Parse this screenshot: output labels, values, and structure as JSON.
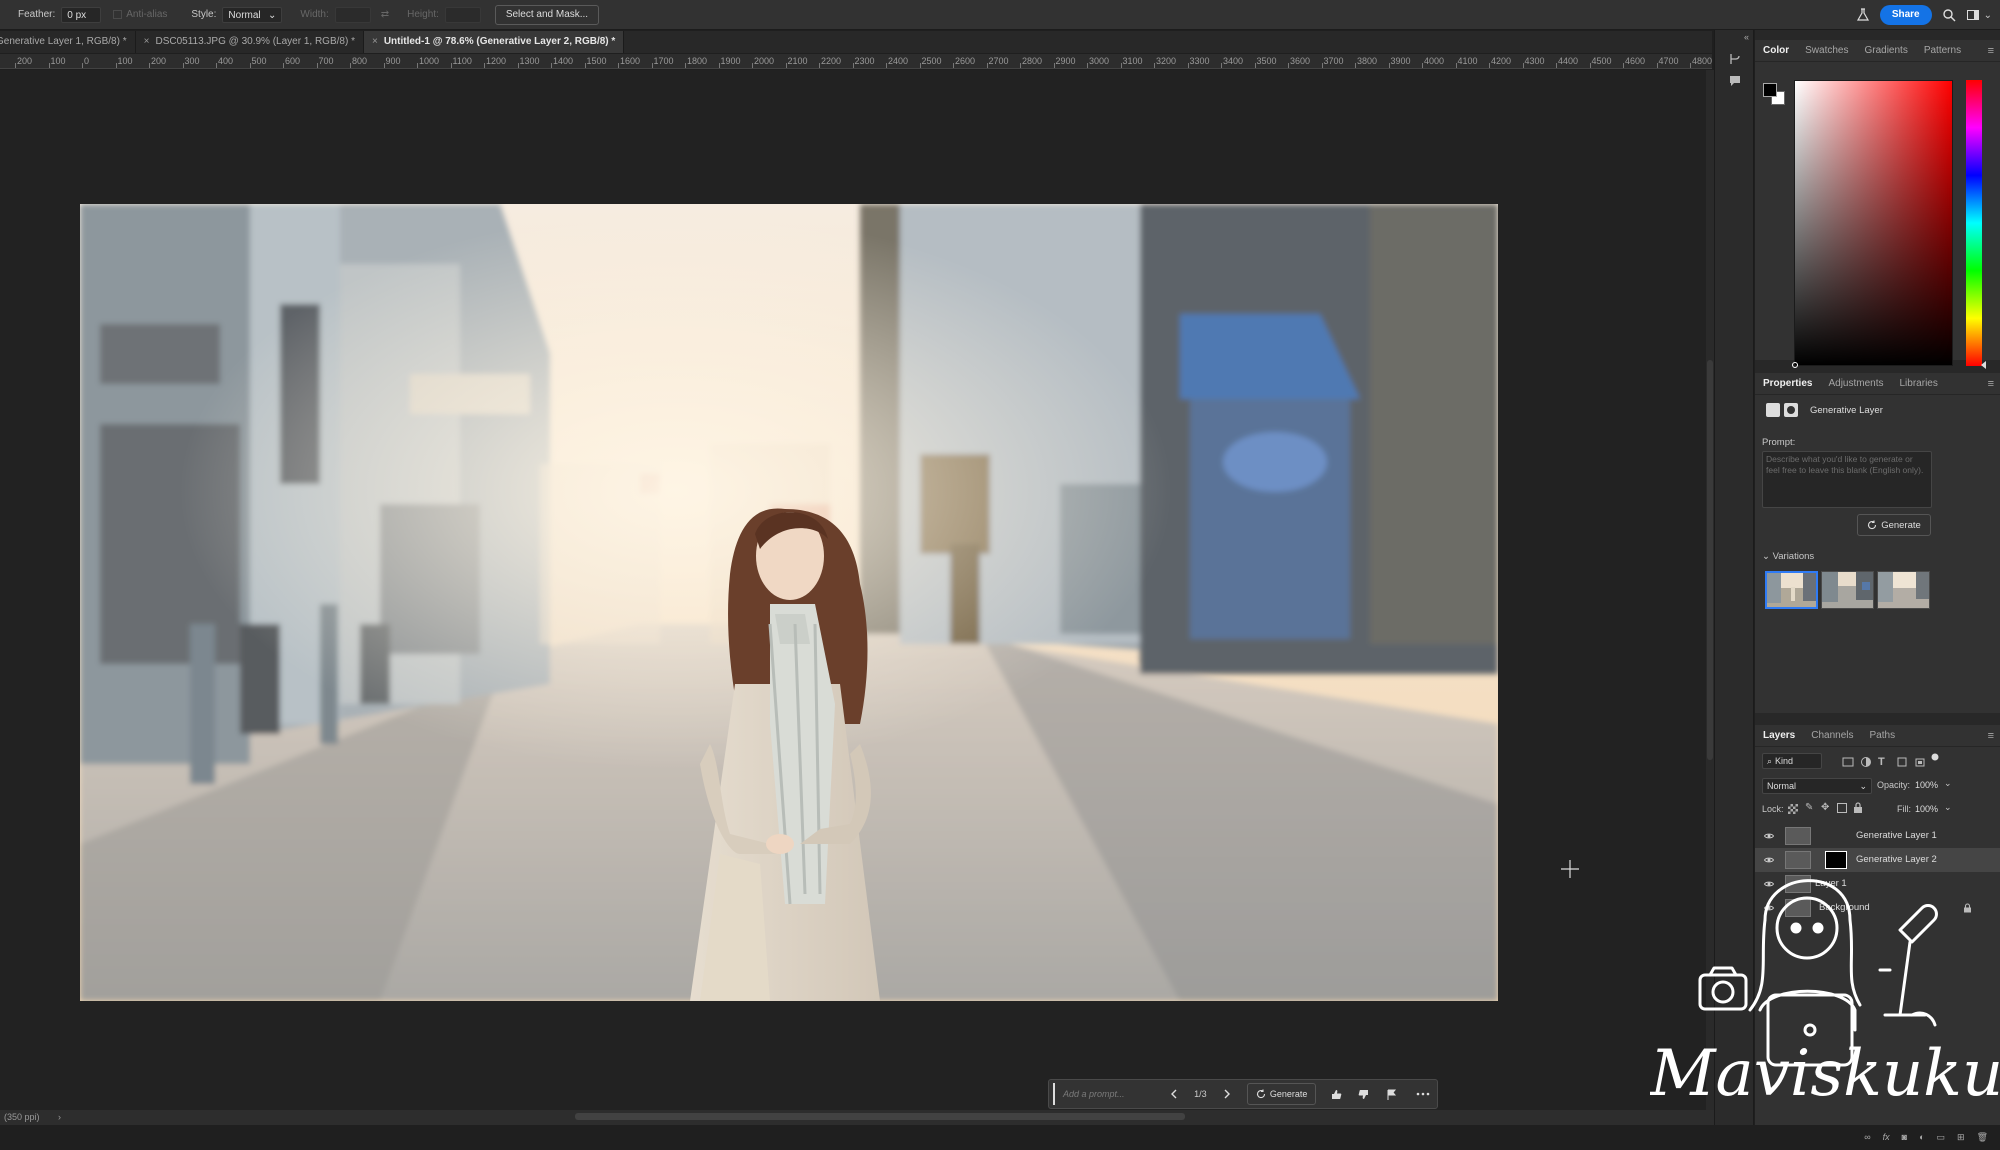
{
  "options_bar": {
    "feather_label": "Feather:",
    "feather_value": "0 px",
    "antialias_label": "Anti-alias",
    "style_label": "Style:",
    "style_value": "Normal",
    "width_label": "Width:",
    "height_label": "Height:",
    "select_mask_label": "Select and Mask...",
    "share_label": "Share"
  },
  "doc_tabs": [
    {
      "label": "Generative Layer 1, RGB/8) *",
      "active": false
    },
    {
      "label": "DSC05113.JPG @ 30.9% (Layer 1, RGB/8) *",
      "active": false
    },
    {
      "label": "Untitled-1 @ 78.6% (Generative Layer 2, RGB/8) *",
      "active": true
    }
  ],
  "ruler_labels": [
    "200",
    "100",
    "0",
    "100",
    "200",
    "300",
    "400",
    "500",
    "600",
    "700",
    "800",
    "900",
    "1000",
    "1100",
    "1200",
    "1300",
    "1400",
    "1500",
    "1600",
    "1700",
    "1800",
    "1900",
    "2000",
    "2100",
    "2200",
    "2300",
    "2400",
    "2500",
    "2600",
    "2700",
    "2800",
    "2900",
    "3000",
    "3100",
    "3200",
    "3300",
    "3400",
    "3500",
    "3600",
    "3700",
    "3800",
    "3900",
    "4000",
    "4100",
    "4200",
    "4300",
    "4400",
    "4500",
    "4600",
    "4700",
    "4800"
  ],
  "contextual_bar": {
    "prompt_placeholder": "Add a prompt...",
    "counter": "1/3",
    "generate_label": "Generate"
  },
  "status_bar": {
    "resolution": "(350 ppi)"
  },
  "color_panel": {
    "tabs": [
      "Color",
      "Swatches",
      "Gradients",
      "Patterns"
    ],
    "picker_hue": "#ff0000"
  },
  "properties_panel": {
    "tabs": [
      "Properties",
      "Adjustments",
      "Libraries"
    ],
    "layer_type": "Generative Layer",
    "prompt_label": "Prompt:",
    "prompt_placeholder": "Describe what you'd like to generate or feel free to leave this blank (English only).",
    "generate_label": "Generate",
    "variations_label": "Variations"
  },
  "layers_panel": {
    "tabs": [
      "Layers",
      "Channels",
      "Paths"
    ],
    "filter_kind": "Kind",
    "blend_mode": "Normal",
    "opacity_label": "Opacity:",
    "opacity_value": "100%",
    "lock_label": "Lock:",
    "fill_label": "Fill:",
    "fill_value": "100%",
    "layers": [
      {
        "name": "Generative Layer 1",
        "selected": false,
        "locked": false
      },
      {
        "name": "Generative Layer 2",
        "selected": true,
        "locked": false
      },
      {
        "name": "Layer 1",
        "selected": false,
        "locked": false
      },
      {
        "name": "Background",
        "selected": false,
        "locked": true
      }
    ]
  },
  "watermark_text": "Maviskuku",
  "colors": {
    "accent": "#1473e6",
    "selection": "#2f7bf5"
  }
}
